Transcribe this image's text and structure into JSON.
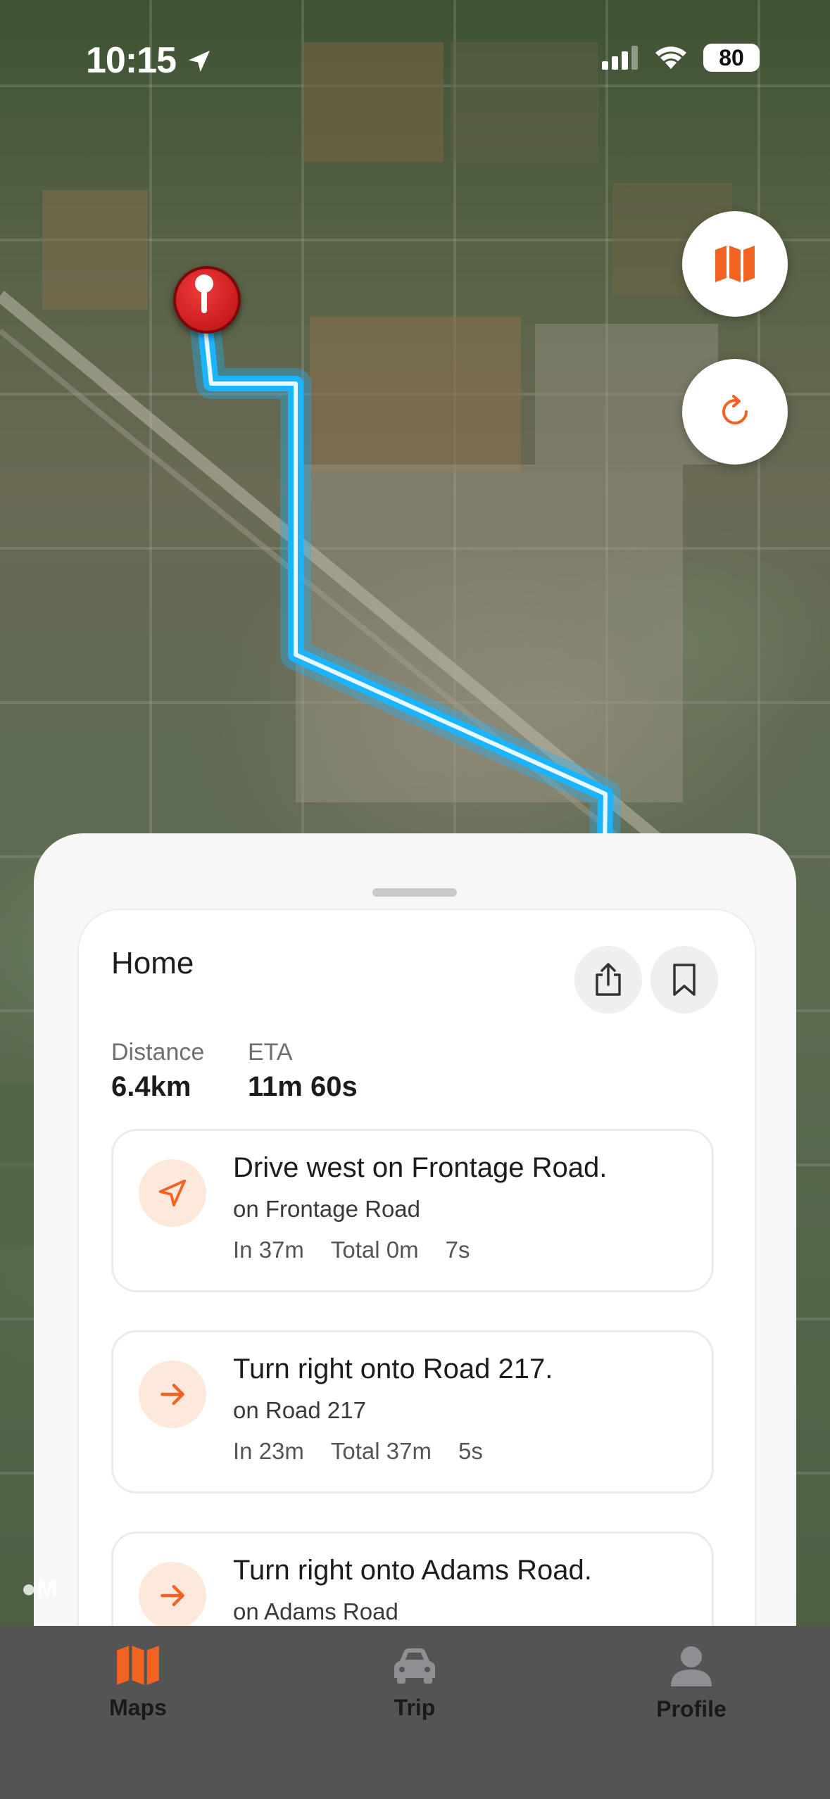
{
  "status_bar": {
    "time": "10:15",
    "battery": "80"
  },
  "map": {
    "legal_mark": "M",
    "route_color": "#1db4ff"
  },
  "sheet": {
    "title": "Home",
    "distance_label": "Distance",
    "distance_value": "6.4km",
    "eta_label": "ETA",
    "eta_value": "11m 60s",
    "steps": [
      {
        "title": "Drive west on Frontage Road.",
        "road": "on Frontage Road",
        "in": "In 37m",
        "total": "Total 0m",
        "time": "7s",
        "icon": "navigation-arrow-icon"
      },
      {
        "title": "Turn right onto Road 217.",
        "road": "on Road 217",
        "in": "In 23m",
        "total": "Total 37m",
        "time": "5s",
        "icon": "arrow-right-icon"
      },
      {
        "title": "Turn right onto Adams Road.",
        "road": "on Adams Road",
        "icon": "arrow-right-icon"
      }
    ]
  },
  "tabs": [
    {
      "label": "Maps",
      "icon": "map-icon",
      "active": true
    },
    {
      "label": "Trip",
      "icon": "car-icon",
      "active": false
    },
    {
      "label": "Profile",
      "icon": "person-icon",
      "active": false
    }
  ],
  "colors": {
    "accent": "#f26322",
    "tab_inactive": "#8e8e93",
    "tabbar_bg": "#545454"
  }
}
